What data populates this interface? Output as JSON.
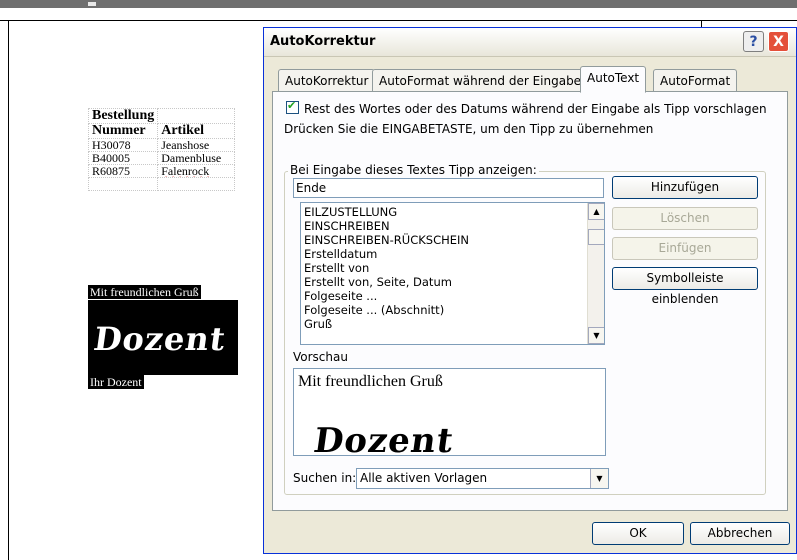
{
  "document": {
    "table": {
      "header_title": "Bestellung",
      "columns": [
        "Nummer",
        "Artikel"
      ],
      "rows": [
        [
          "H30078",
          "Jeanshose"
        ],
        [
          "B40005",
          "Damenbluse"
        ],
        [
          "R60875",
          "Falenrock"
        ]
      ]
    },
    "closing_line": "Mit freundlichen Gruß",
    "signature": "Dozent",
    "signoff": "Ihr Dozent"
  },
  "dialog": {
    "title": "AutoKorrektur",
    "help_label": "?",
    "close_label": "X",
    "tabs": [
      {
        "label": "AutoKorrektur"
      },
      {
        "label": "AutoFormat während der Eingabe"
      },
      {
        "label": "AutoText",
        "active": true
      },
      {
        "label": "AutoFormat"
      }
    ],
    "suggest_checkbox": {
      "label": "Rest des Wortes oder des Datums während der Eingabe als Tipp vorschlagen",
      "checked": true
    },
    "hint": "Drücken Sie die EINGABETASTE, um den Tipp zu übernehmen",
    "group_label": "Bei Eingabe dieses Textes Tipp anzeigen:",
    "input_value": "Ende",
    "list_items": [
      "EILZUSTELLUNG",
      "EINSCHREIBEN",
      "EINSCHREIBEN-RÜCKSCHEIN",
      "Erstelldatum",
      "Erstellt von",
      "Erstellt von, Seite, Datum",
      "Folgeseite ...",
      "Folgeseite ... (Abschnitt)",
      "Gruß"
    ],
    "buttons": {
      "add": "Hinzufügen",
      "delete": "Löschen",
      "insert": "Einfügen",
      "toolbar": "Symbolleiste einblenden"
    },
    "preview_label": "Vorschau",
    "preview_line": "Mit freundlichen Gruß",
    "preview_signature": "Dozent",
    "search_label": "Suchen in:",
    "search_value": "Alle aktiven Vorlagen",
    "ok": "OK",
    "cancel": "Abbrechen"
  }
}
